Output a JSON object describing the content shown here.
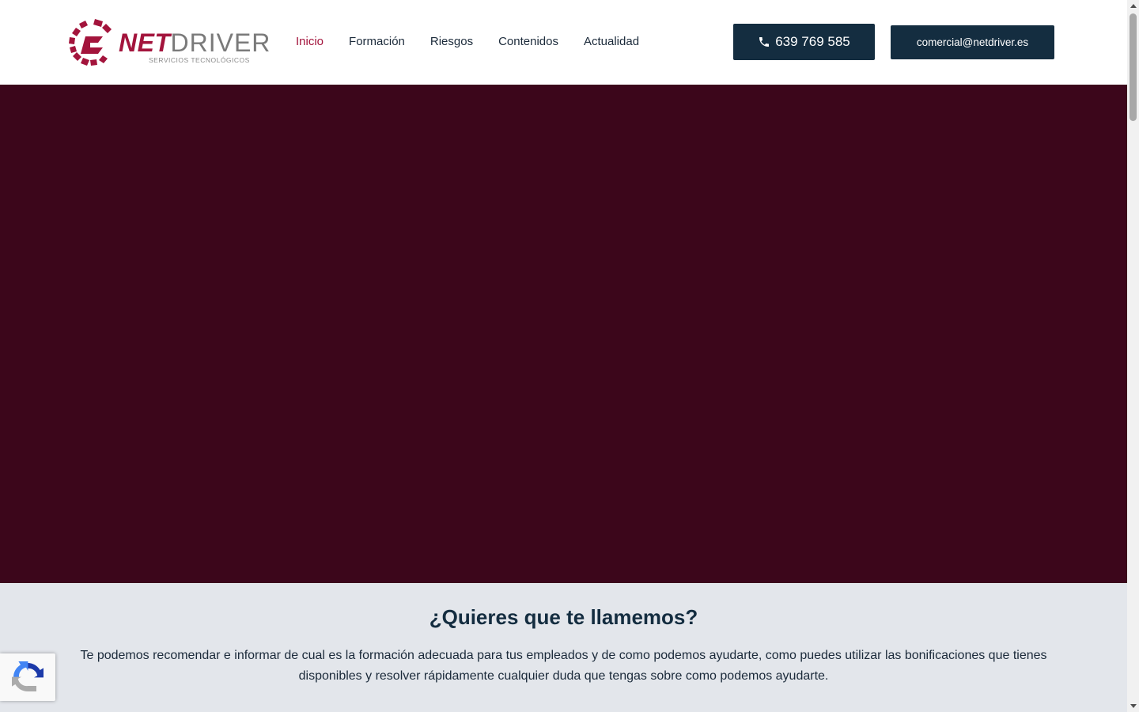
{
  "header": {
    "logo": {
      "brand_primary": "NET",
      "brand_secondary": "DRIVER",
      "tagline": "SERVICIOS TECNOLÓGICOS"
    },
    "nav": [
      {
        "label": "Inicio",
        "active": true
      },
      {
        "label": "Formación",
        "active": false
      },
      {
        "label": "Riesgos",
        "active": false
      },
      {
        "label": "Contenidos",
        "active": false
      },
      {
        "label": "Actualidad",
        "active": false
      }
    ],
    "phone_button": {
      "label": "639 769 585",
      "icon": "phone-icon"
    },
    "email_button": {
      "label": "comercial@netdriver.es"
    }
  },
  "callback": {
    "title": "¿Quieres que te llamemos?",
    "text": "Te podemos recomendar e informar de cual es la formación adecuada para tus empleados y de como podemos ayudarte, como puedes utilizar las bonificaciones que tienes disponibles y resolver rápidamente cualquier duda que tengas sobre como podemos ayudarte."
  },
  "colors": {
    "brand_red": "#a3143c",
    "navy": "#142d40",
    "hero_bg": "#3c061b",
    "section_bg": "#e3e6eb"
  },
  "icons": {
    "recaptcha": "recaptcha-icon"
  }
}
